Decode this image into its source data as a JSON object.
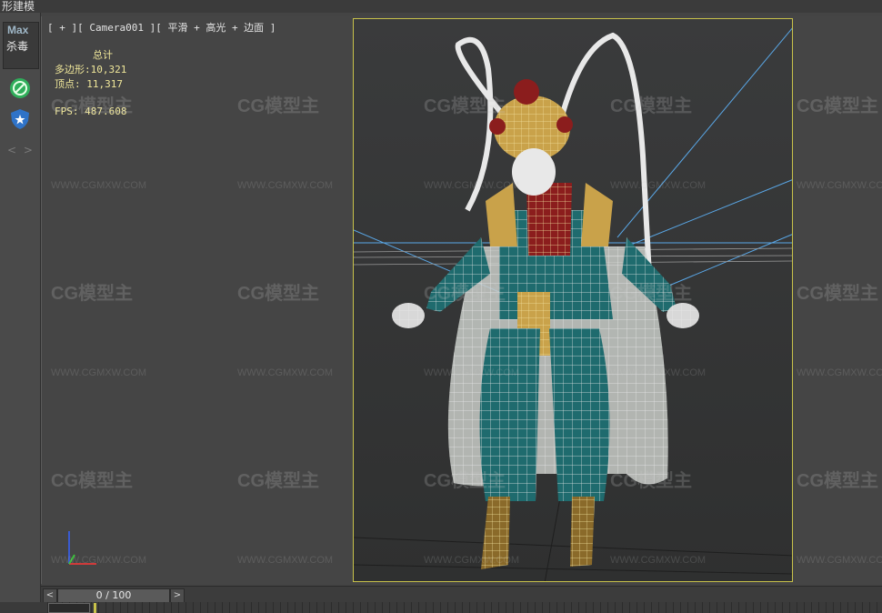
{
  "title_strip": {
    "text": "形建模"
  },
  "left_panel": {
    "max_label": "Max",
    "max_sub": "杀毒",
    "tools": [
      {
        "icon": "no-cursor-icon",
        "color": "#2fae5a"
      },
      {
        "icon": "shield-icon",
        "color": "#2f73c8"
      }
    ],
    "nav_arrows": "< >"
  },
  "viewport": {
    "label": "[ + ][ Camera001 ][ 平滑 + 高光 + 边面 ]",
    "stats": {
      "total_label": "总计",
      "polygons": "多边形:10,321",
      "vertices": "顶点: 11,317",
      "fps": "FPS:   487.608"
    },
    "frame_color": "#c8c24a"
  },
  "watermarks": {
    "logo": "CG模型主",
    "url": "WWW.CGMXW.COM"
  },
  "timeline": {
    "prev": "<",
    "next": ">",
    "frame": "0 / 100",
    "progress": 0
  }
}
